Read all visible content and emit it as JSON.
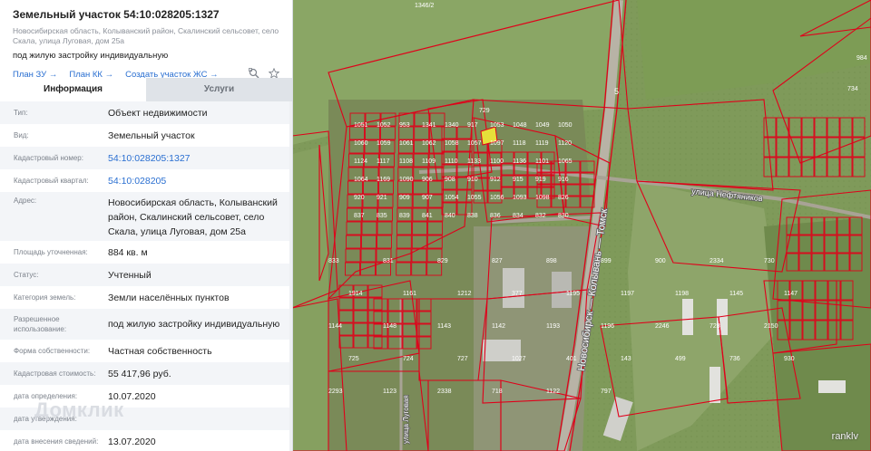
{
  "panel": {
    "title": "Земельный участок 54:10:028205:1327",
    "address_line1": "Новосибирская область, Колыванский район, Скалинский сельсовет, село",
    "address_line2": "Скала, улица Луговая, дом 25а",
    "purpose": "под жилую застройку индивидуальную",
    "links": [
      "План ЗУ →",
      "План КК →",
      "Создать участок ЖС →"
    ],
    "tabs": {
      "info": "Информация",
      "services": "Услуги"
    },
    "rows": [
      {
        "label": "Тип:",
        "value": "Объект недвижимости"
      },
      {
        "label": "Вид:",
        "value": "Земельный участок"
      },
      {
        "label": "Кадастровый номер:",
        "value": "54:10:028205:1327"
      },
      {
        "label": "Кадастровый квартал:",
        "value": "54:10:028205"
      },
      {
        "label": "Адрес:",
        "value": "Новосибирская область, Колыванский район, Скалинский сельсовет, село Скала, улица Луговая, дом 25а"
      },
      {
        "label": "Площадь уточненная:",
        "value": "884 кв. м"
      },
      {
        "label": "Статус:",
        "value": "Учтенный"
      },
      {
        "label": "Категория земель:",
        "value": "Земли населённых пунктов"
      },
      {
        "label": "Разрешенное использование:",
        "value": "под жилую застройку индивидуальную"
      },
      {
        "label": "Форма собственности:",
        "value": "Частная собственность"
      },
      {
        "label": "Кадастровая стоимость:",
        "value": "55 417,96 руб."
      },
      {
        "label": "дата определения:",
        "value": "10.07.2020"
      },
      {
        "label": "дата утверждения:",
        "value": ""
      },
      {
        "label": "дата внесения сведений:",
        "value": "13.07.2020"
      }
    ],
    "watermark": "Домклик"
  },
  "map": {
    "credit": "ranklv",
    "road_label": "Новосибирск — Колывань — Томск",
    "street_label": "улица Нефтяников",
    "street_label2": "улица Луговая",
    "road_number": "5",
    "parcel_labels": [
      "1346/2",
      "984",
      "734",
      "729",
      "1051",
      "1052",
      "953",
      "1341",
      "1340",
      "917",
      "1053",
      "1048",
      "1049",
      "1050",
      "1060",
      "1059",
      "1061",
      "1062",
      "1058",
      "1057",
      "1097",
      "1118",
      "1119",
      "1120",
      "1124",
      "1117",
      "1108",
      "1109",
      "1110",
      "1133",
      "1100",
      "1136",
      "1101",
      "1065",
      "1064",
      "1169",
      "1090",
      "906",
      "908",
      "910",
      "912",
      "915",
      "919",
      "916",
      "920",
      "921",
      "909",
      "907",
      "1054",
      "1055",
      "1056",
      "1093",
      "1098",
      "826",
      "837",
      "835",
      "839",
      "841",
      "840",
      "838",
      "836",
      "834",
      "832",
      "830",
      "833",
      "831",
      "829",
      "827",
      "898",
      "899",
      "900",
      "2334",
      "730",
      "1914",
      "1161",
      "1212",
      "377",
      "1195",
      "1197",
      "1198",
      "1145",
      "1147",
      "1144",
      "1148",
      "1143",
      "1142",
      "1193",
      "1196",
      "2246",
      "728",
      "2150",
      "725",
      "724",
      "727",
      "1027",
      "401",
      "143",
      "499",
      "736",
      "930",
      "2293",
      "1123",
      "2338",
      "718",
      "1122",
      "797"
    ]
  },
  "colors": {
    "accent_link": "#2a6fd1",
    "parcel_line": "#e0001a",
    "selected_parcel": "#e6e03a"
  }
}
